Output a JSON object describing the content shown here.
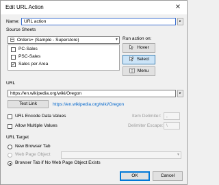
{
  "window": {
    "title": "Edit URL Action",
    "close_glyph": "✕"
  },
  "name": {
    "label": "Name:",
    "value": "URL action",
    "button_glyph": "▸"
  },
  "source_sheets": {
    "title": "Source Sheets",
    "datasource": "Orders+ (Sample - Superstore)",
    "sheets": [
      {
        "label": "PC-Sales",
        "checked": false
      },
      {
        "label": "PSC-Sales",
        "checked": false
      },
      {
        "label": "Sales per Area",
        "checked": true
      }
    ]
  },
  "run_action": {
    "title": "Run action on:",
    "options": [
      {
        "label": "Hover",
        "icon": "hover-pointer-icon",
        "selected": false
      },
      {
        "label": "Select",
        "icon": "select-pointer-icon",
        "selected": true
      },
      {
        "label": "Menu",
        "icon": "menu-icon",
        "selected": false
      }
    ]
  },
  "url": {
    "title": "URL",
    "value": "https://en.wikipedia.org/wiki/Oregon",
    "button_glyph": "▸",
    "test_link_label": "Test Link",
    "preview": "https://en.wikipedia.org/wiki/Oregon",
    "encode_label": "URL Encode Data Values",
    "multiple_label": "Allow Multiple Values",
    "item_delimiter_label": "Item Delimiter:",
    "item_delimiter_value": ",",
    "delimiter_escape_label": "Delimiter Escape:",
    "delimiter_escape_value": "\\"
  },
  "url_target": {
    "title": "URL Target",
    "options": [
      {
        "label": "New Browser Tab",
        "checked": false,
        "enabled": true
      },
      {
        "label": "Web Page Object",
        "checked": false,
        "enabled": false
      },
      {
        "label": "Browser Tab if No Web Page Object Exists",
        "checked": true,
        "enabled": true
      }
    ]
  },
  "buttons": {
    "ok": "OK",
    "cancel": "Cancel"
  }
}
